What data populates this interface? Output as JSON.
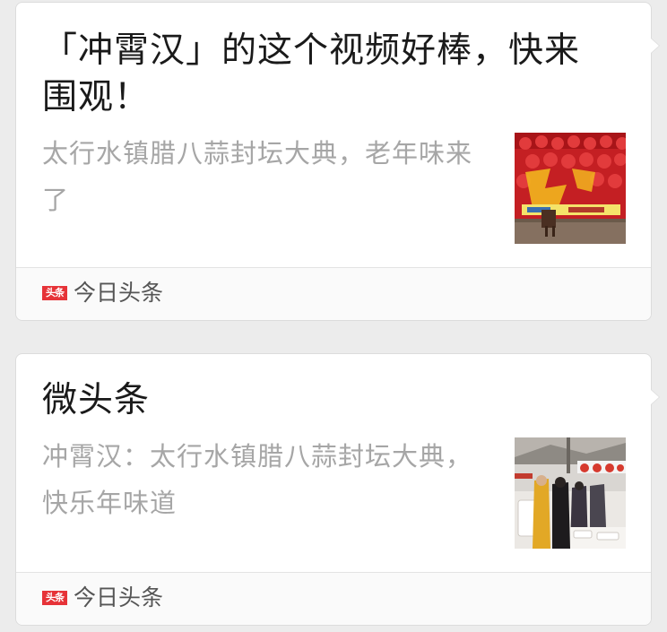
{
  "colors": {
    "background": "#ececec",
    "card": "#ffffff",
    "title": "#1a1a1a",
    "description": "#a6a6a6",
    "source_logo": "#e63338"
  },
  "cards": [
    {
      "title": "「冲霄汉」的这个视频好棒，快来围观！",
      "description": "太行水镇腊八蒜封坛大典，老年味来了",
      "thumbnail": "red-lanterns-banner-photo",
      "source": {
        "logo_text": "头条",
        "logo_icon": "toutiao-logo-icon",
        "name": "今日头条"
      }
    },
    {
      "title": "微头条",
      "description": "冲霄汉：太行水镇腊八蒜封坛大典，快乐年味道",
      "thumbnail": "ceremony-crowd-photo",
      "source": {
        "logo_text": "头条",
        "logo_icon": "toutiao-logo-icon",
        "name": "今日头条"
      }
    }
  ]
}
